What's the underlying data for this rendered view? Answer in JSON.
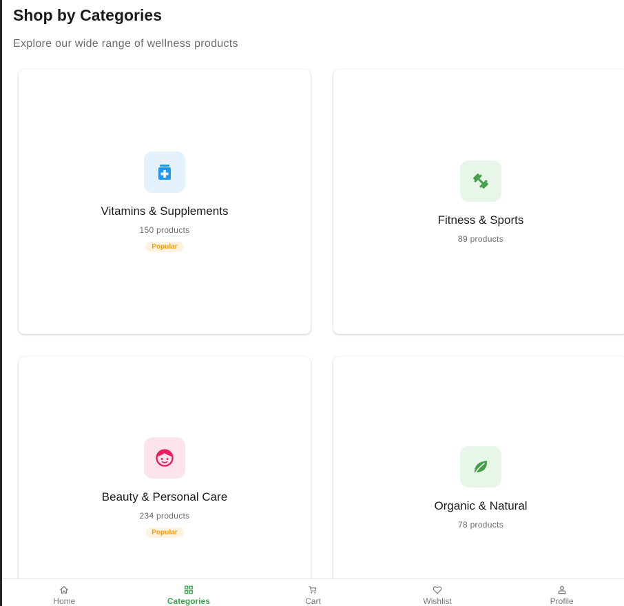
{
  "header": {
    "title": "Shop by Categories",
    "subtitle": "Explore our wide range of wellness products"
  },
  "categories": [
    {
      "name": "Vitamins & Supplements",
      "count": "150 products",
      "badge": "Popular",
      "icon": "medication-icon",
      "icon_bg": "#e3f2fd",
      "icon_color": "#2196f3"
    },
    {
      "name": "Fitness & Sports",
      "count": "89 products",
      "badge": "",
      "icon": "dumbbell-icon",
      "icon_bg": "#e8f5e9",
      "icon_color": "#43a047"
    },
    {
      "name": "Beauty & Personal Care",
      "count": "234 products",
      "badge": "Popular",
      "icon": "face-icon",
      "icon_bg": "#fce4ec",
      "icon_color": "#e91e63"
    },
    {
      "name": "Organic & Natural",
      "count": "78 products",
      "badge": "",
      "icon": "leaf-icon",
      "icon_bg": "#e8f5e9",
      "icon_color": "#43a047"
    }
  ],
  "bottom_nav": {
    "active_color": "#3aa64a",
    "items": [
      {
        "label": "Home",
        "icon": "home-icon",
        "active": false
      },
      {
        "label": "Categories",
        "icon": "grid-icon",
        "active": true
      },
      {
        "label": "Cart",
        "icon": "cart-icon",
        "active": false
      },
      {
        "label": "Wishlist",
        "icon": "heart-icon",
        "active": false
      },
      {
        "label": "Profile",
        "icon": "person-icon",
        "active": false
      }
    ]
  }
}
